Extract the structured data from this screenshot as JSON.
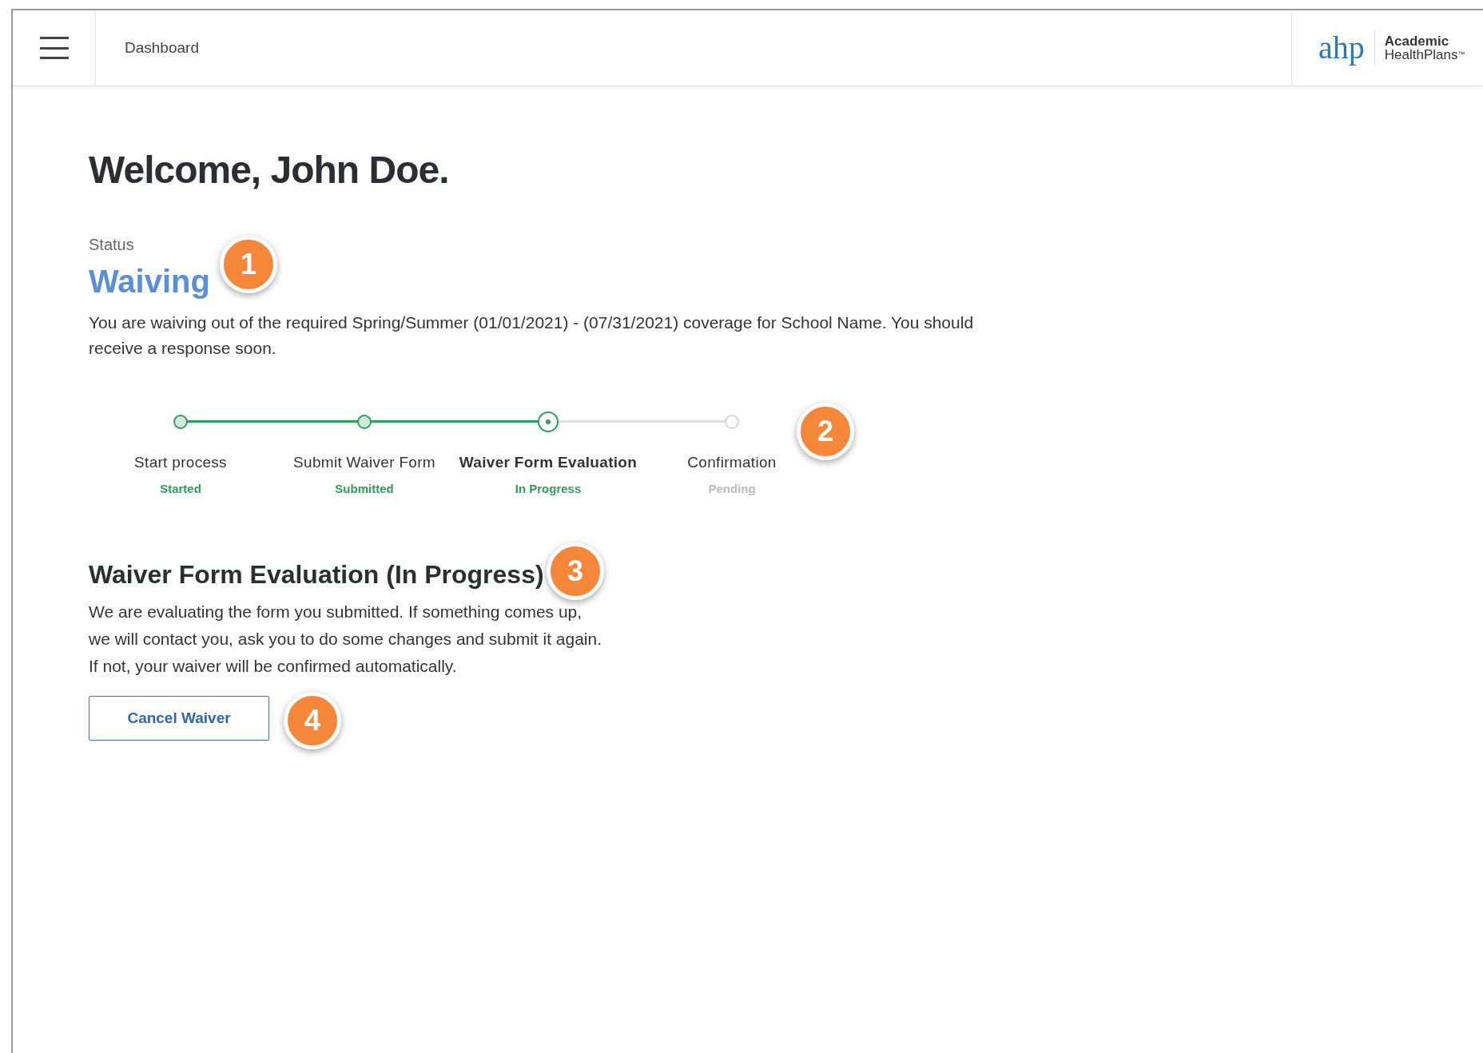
{
  "header": {
    "page_title": "Dashboard",
    "logo": {
      "mark": "ahp",
      "name_line1": "Academic",
      "name_line2": "HealthPlans",
      "trademark": "™"
    }
  },
  "welcome": "Welcome, John Doe.",
  "status": {
    "label": "Status",
    "value": "Waiving",
    "description": "You are waiving out of the required Spring/Summer (01/01/2021) - (07/31/2021) coverage for School Name. You should receive a response soon."
  },
  "steps": [
    {
      "label": "Start process",
      "status": "Started",
      "completed": true,
      "current": false
    },
    {
      "label": "Submit Waiver Form",
      "status": "Submitted",
      "completed": true,
      "current": false
    },
    {
      "label": "Waiver Form Evaluation",
      "status": "In Progress",
      "completed": false,
      "current": true
    },
    {
      "label": "Confirmation",
      "status": "Pending",
      "completed": false,
      "current": false
    }
  ],
  "section": {
    "title": "Waiver Form Evaluation (In Progress)",
    "lines": [
      "We are evaluating the form you submitted. If something comes up,",
      "we will contact you, ask you to do some changes and submit it again.",
      "If not, your waiver will be confirmed automatically."
    ],
    "button": "Cancel Waiver"
  },
  "callouts": [
    "1",
    "2",
    "3",
    "4"
  ]
}
